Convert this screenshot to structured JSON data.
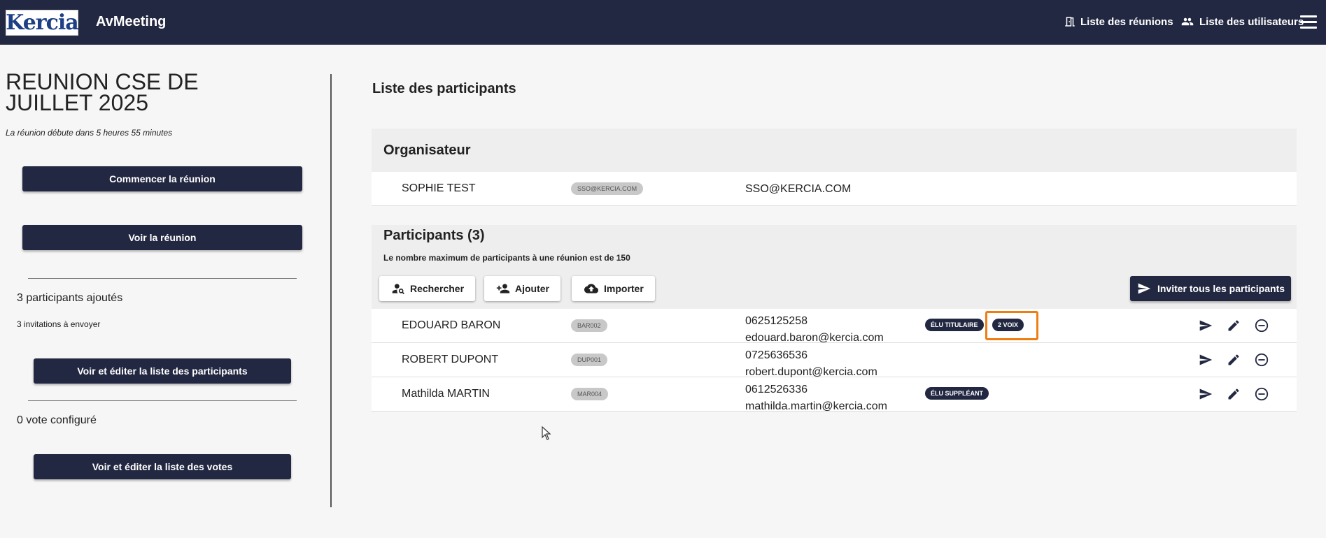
{
  "header": {
    "logo_text": "Kercia",
    "app_name": "AvMeeting",
    "nav_meetings": "Liste des réunions",
    "nav_users": "Liste des utilisateurs"
  },
  "left": {
    "meeting_title": "REUNION CSE DE JUILLET 2025",
    "meeting_subtitle": "La réunion débute dans 5 heures 55 minutes",
    "start_button": "Commencer la réunion",
    "view_button": "Voir la réunion",
    "participants_added": "3 participants ajoutés",
    "invitations_to_send": "3 invitations à envoyer",
    "edit_participants_button": "Voir et éditer la liste des participants",
    "votes_configured": "0 vote configuré",
    "edit_votes_button": "Voir et éditer la liste des votes"
  },
  "main": {
    "section_title": "Liste des participants",
    "organizer_heading": "Organisateur",
    "organizer": {
      "name": "SOPHIE TEST",
      "code": "SSO@KERCIA.COM",
      "email": "SSO@KERCIA.COM"
    },
    "participants_heading": "Participants (3)",
    "participants_note": "Le nombre maximum de participants à une réunion est de 150",
    "search_button": "Rechercher",
    "add_button": "Ajouter",
    "import_button": "Importer",
    "invite_all_button": "Inviter tous les participants",
    "participants": [
      {
        "name": "EDOUARD BARON",
        "code": "BAR002",
        "phone": "0625125258",
        "email": "edouard.baron@kercia.com",
        "badges": [
          "ÉLU TITULAIRE",
          "2 VOIX"
        ]
      },
      {
        "name": "ROBERT DUPONT",
        "code": "DUP001",
        "phone": "0725636536",
        "email": "robert.dupont@kercia.com",
        "badges": []
      },
      {
        "name": "Mathilda MARTIN",
        "code": "MAR004",
        "phone": "0612526336",
        "email": "mathilda.martin@kercia.com",
        "badges": [
          "ÉLU SUPPLÉANT"
        ]
      }
    ]
  },
  "colors": {
    "primary": "#232842",
    "background": "#f6f6f6",
    "highlight": "#ef7d10",
    "chip": "#c8c8c8"
  },
  "icons": [
    "door-icon",
    "users-icon",
    "menu-icon",
    "person-search-icon",
    "person-add-icon",
    "cloud-upload-icon",
    "send-icon",
    "edit-icon",
    "remove-circle-icon",
    "cursor-icon"
  ]
}
